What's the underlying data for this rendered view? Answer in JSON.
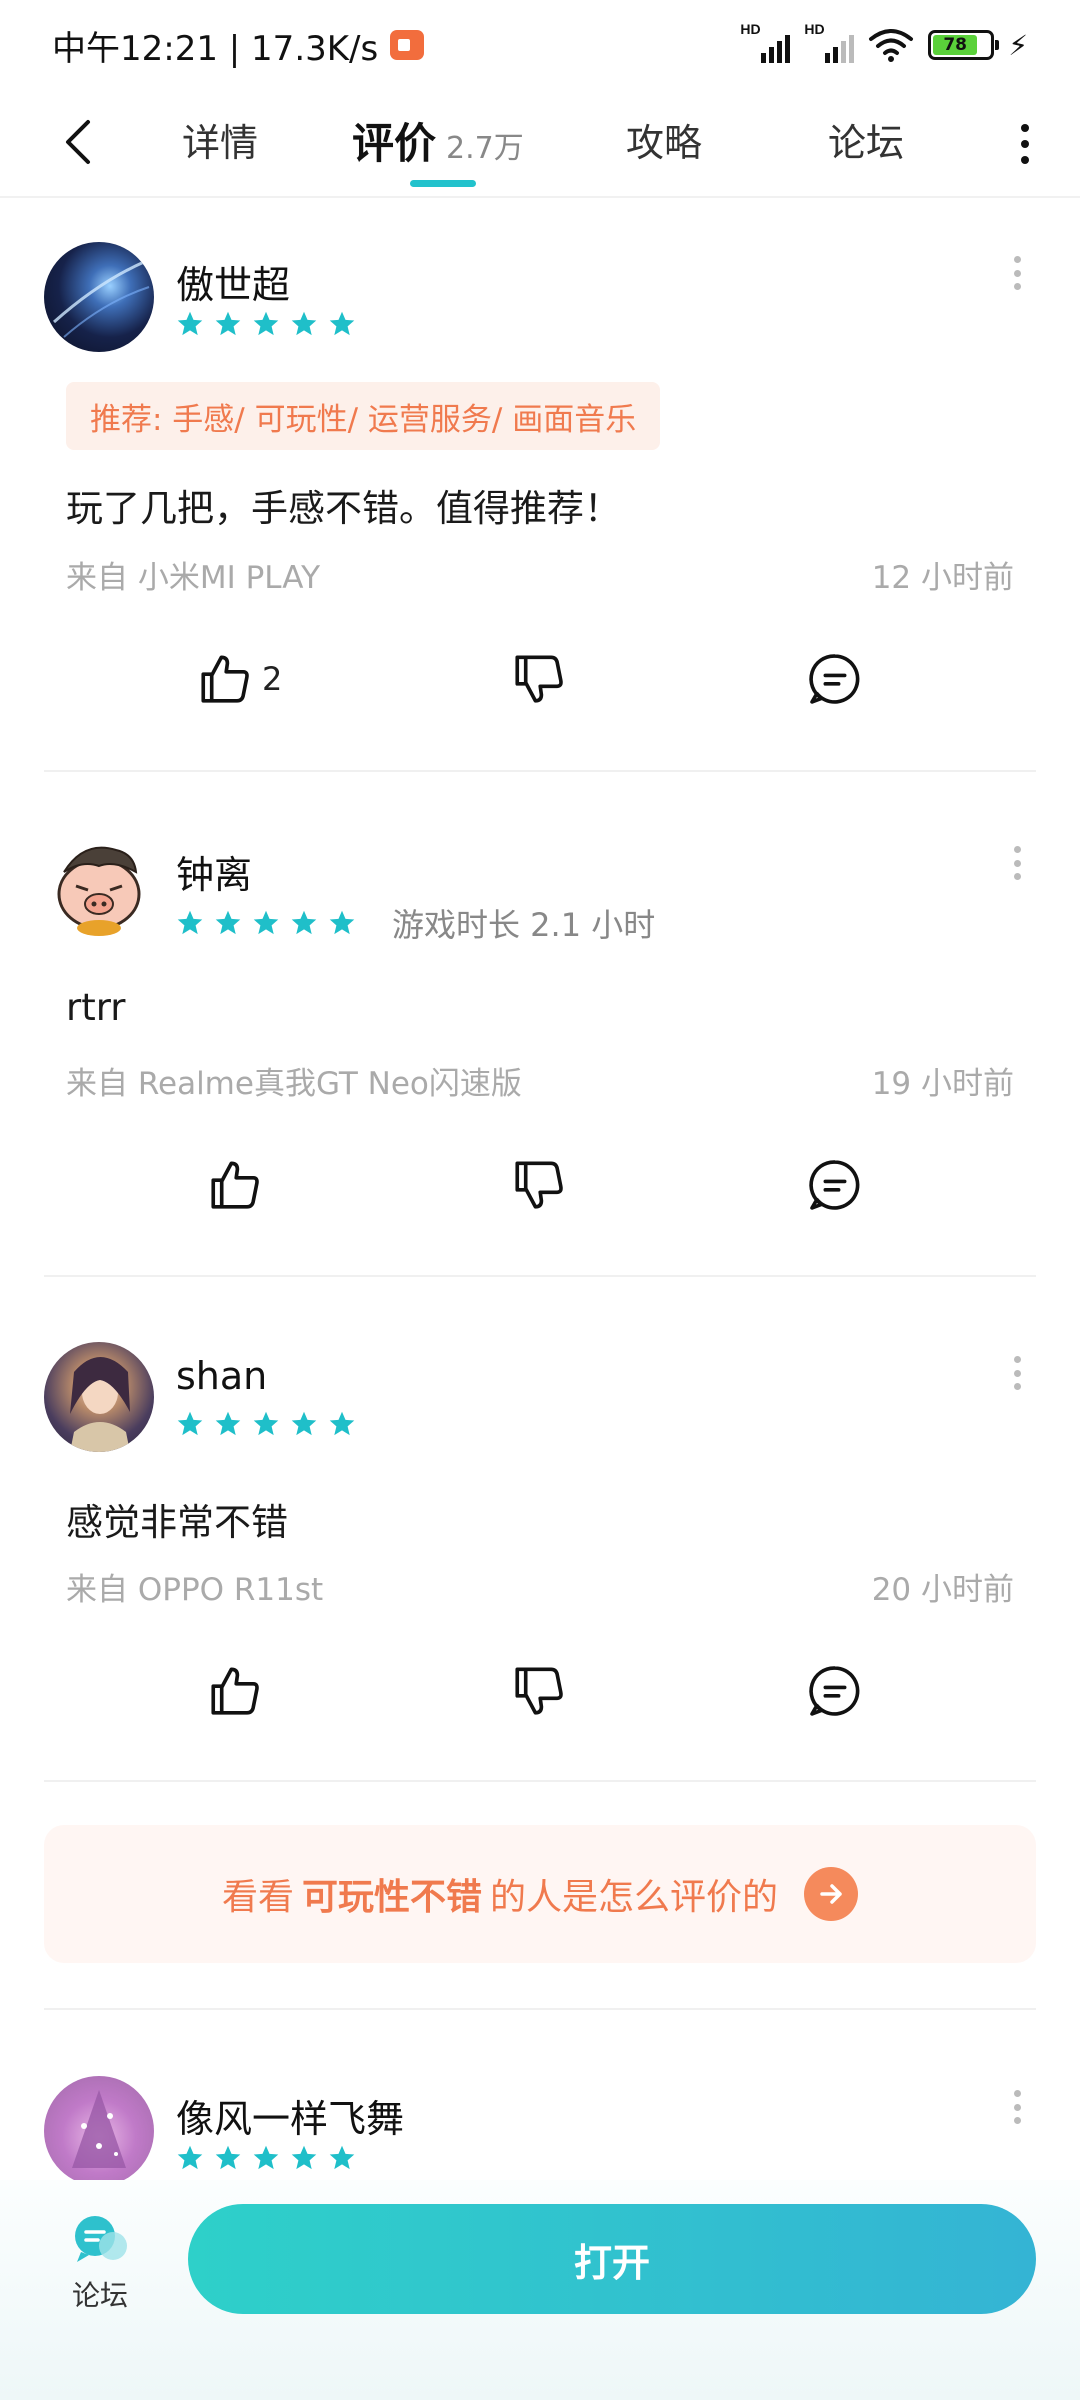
{
  "status_bar": {
    "time_speed": "中午12:21 | 17.3K/s",
    "hd1": "HD",
    "hd2": "HD",
    "battery": "78"
  },
  "nav": {
    "tabs": [
      {
        "label": "详情"
      },
      {
        "label": "评价",
        "count": "2.7万"
      },
      {
        "label": "攻略"
      },
      {
        "label": "论坛"
      }
    ],
    "active_tab": 1
  },
  "colors": {
    "accent": "#22c2cc",
    "star": "#1fbfc9",
    "tag": "#f07a4e"
  },
  "reviews": [
    {
      "username": "傲世超",
      "stars": 5,
      "tag": "推荐: 手感/ 可玩性/ 运营服务/ 画面音乐",
      "content": "玩了几把，手感不错。值得推荐！",
      "source": "来自 小米MI PLAY",
      "time": "12 小时前",
      "likes": "2"
    },
    {
      "username": "钟离",
      "stars": 5,
      "playtime": "游戏时长 2.1 小时",
      "content": "rtrr",
      "source": "来自 Realme真我GT Neo闪速版",
      "time": "19 小时前"
    },
    {
      "username": "shan",
      "stars": 5,
      "content": "感觉非常不错",
      "source": "来自 OPPO R11st",
      "time": "20 小时前"
    },
    {
      "username": "像风一样飞舞",
      "stars": 5
    }
  ],
  "promo": {
    "prefix": "看看",
    "highlight": "可玩性不错",
    "suffix": "的人是怎么评价的"
  },
  "bottom": {
    "forum_label": "论坛",
    "open_label": "打开"
  }
}
